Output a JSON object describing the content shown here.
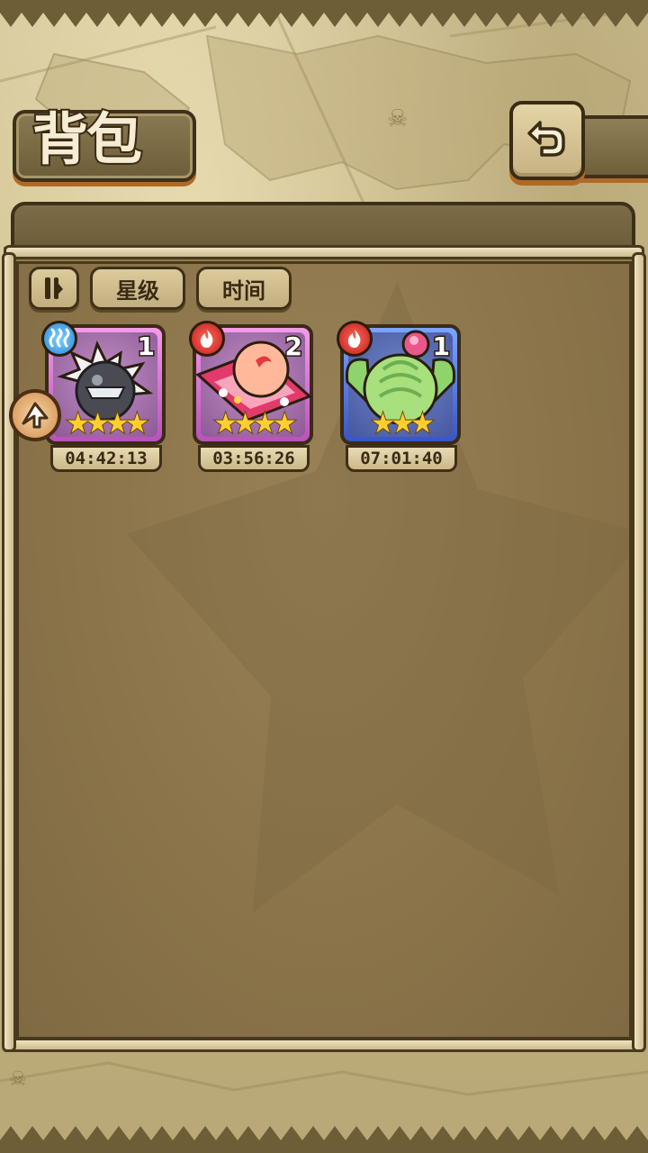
{
  "header": {
    "title": "背包",
    "back_icon": "back-arrow-icon"
  },
  "toolbar": {
    "sort_icon": "sort-toggle-icon",
    "star_label": "星级",
    "time_label": "时间"
  },
  "items": [
    {
      "element": "water",
      "count": "1",
      "stars": "★★★★",
      "timer": "04:42:13",
      "rarity_color": "#d86fd6"
    },
    {
      "element": "fire",
      "count": "2",
      "stars": "★★★★",
      "timer": "03:56:26",
      "rarity_color": "#d86fd6"
    },
    {
      "element": "fire",
      "count": "1",
      "stars": "★★★",
      "timer": "07:01:40",
      "rarity_color": "#4f6fe6"
    }
  ],
  "colors": {
    "parchment": "#c6b583",
    "panel": "#8a7349",
    "accent_orange": "#b06a24",
    "star_gold": "#ffcf2f"
  }
}
